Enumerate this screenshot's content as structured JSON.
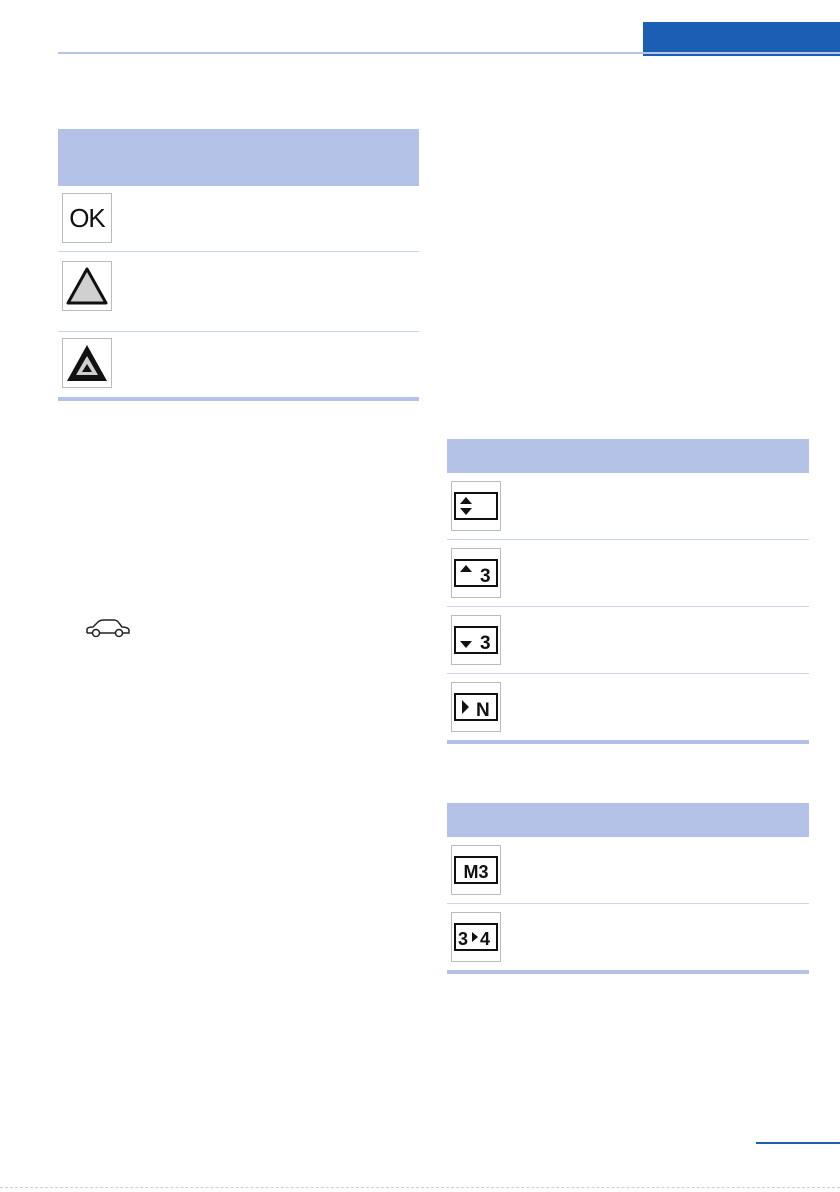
{
  "header": {
    "accent_color": "#1a5fb4",
    "rule_color": "#b8c4e6"
  },
  "table_status": {
    "header_color": "#b4c2e8",
    "rows": [
      {
        "icon": "ok-symbol-icon",
        "text": "OK"
      },
      {
        "icon": "warning-triangle-grey-icon"
      },
      {
        "icon": "warning-triangle-black-icon"
      }
    ]
  },
  "car_symbol": {
    "icon": "car-icon"
  },
  "table_gear_shift": {
    "rows": [
      {
        "icon": "shift-up-down-icon"
      },
      {
        "icon": "upshift-3-icon",
        "text": "3"
      },
      {
        "icon": "downshift-3-icon",
        "text": "3"
      },
      {
        "icon": "neutral-N-icon",
        "text": "N"
      }
    ]
  },
  "table_gear_display": {
    "rows": [
      {
        "icon": "manual-M3-icon",
        "text": "M3"
      },
      {
        "icon": "shift-3-to-4-icon",
        "text_left": "3",
        "text_right": "4"
      }
    ]
  }
}
